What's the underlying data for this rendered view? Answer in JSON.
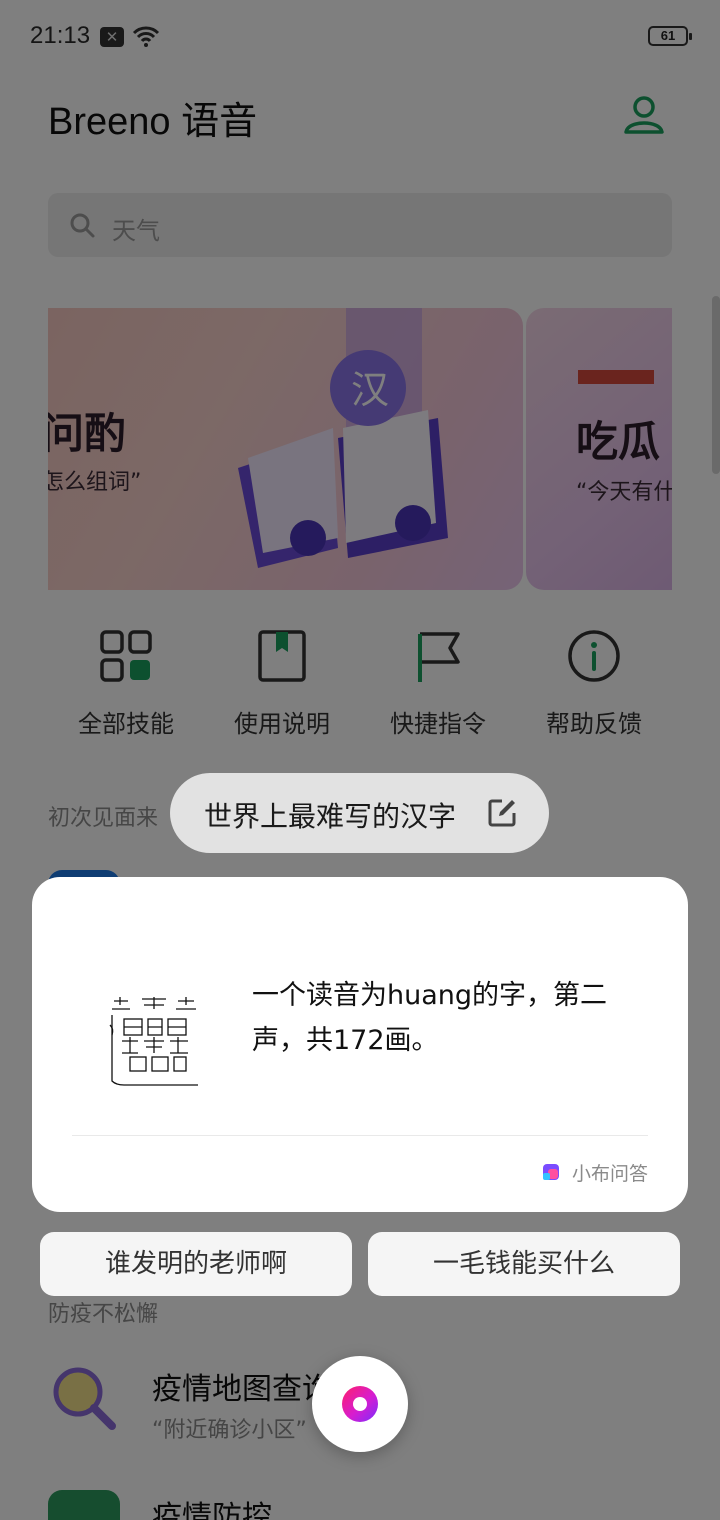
{
  "status_bar": {
    "time": "21:13",
    "battery": "61"
  },
  "app": {
    "title": "Breeno 语音"
  },
  "search": {
    "placeholder": "天气"
  },
  "banners": [
    {
      "title": "问酌",
      "subtitle": "怎么组词”"
    },
    {
      "title": "吃瓜",
      "subtitle": "“今天有什"
    }
  ],
  "quick_actions": [
    {
      "label": "全部技能",
      "icon": "grid-icon"
    },
    {
      "label": "使用说明",
      "icon": "book-icon"
    },
    {
      "label": "快捷指令",
      "icon": "flag-icon"
    },
    {
      "label": "帮助反馈",
      "icon": "info-icon"
    }
  ],
  "sections": {
    "first_meet": "初次见面来",
    "epidemic": "防疫不松懈"
  },
  "list_items": [
    {
      "title": "疫情地图查询",
      "subtitle": "“附近确诊小区”"
    },
    {
      "title": "疫情防控"
    }
  ],
  "overlay": {
    "query": "世界上最难写的汉字",
    "answer": "一个读音为huang的字，第二声，共172画。",
    "source": "小布问答",
    "suggestions": [
      "谁发明的老师啊",
      "一毛钱能买什么"
    ]
  },
  "colors": {
    "accent_green": "#1aa15f",
    "mic_gradient_start": "#ff1f6a",
    "mic_gradient_end": "#7a2cff"
  }
}
